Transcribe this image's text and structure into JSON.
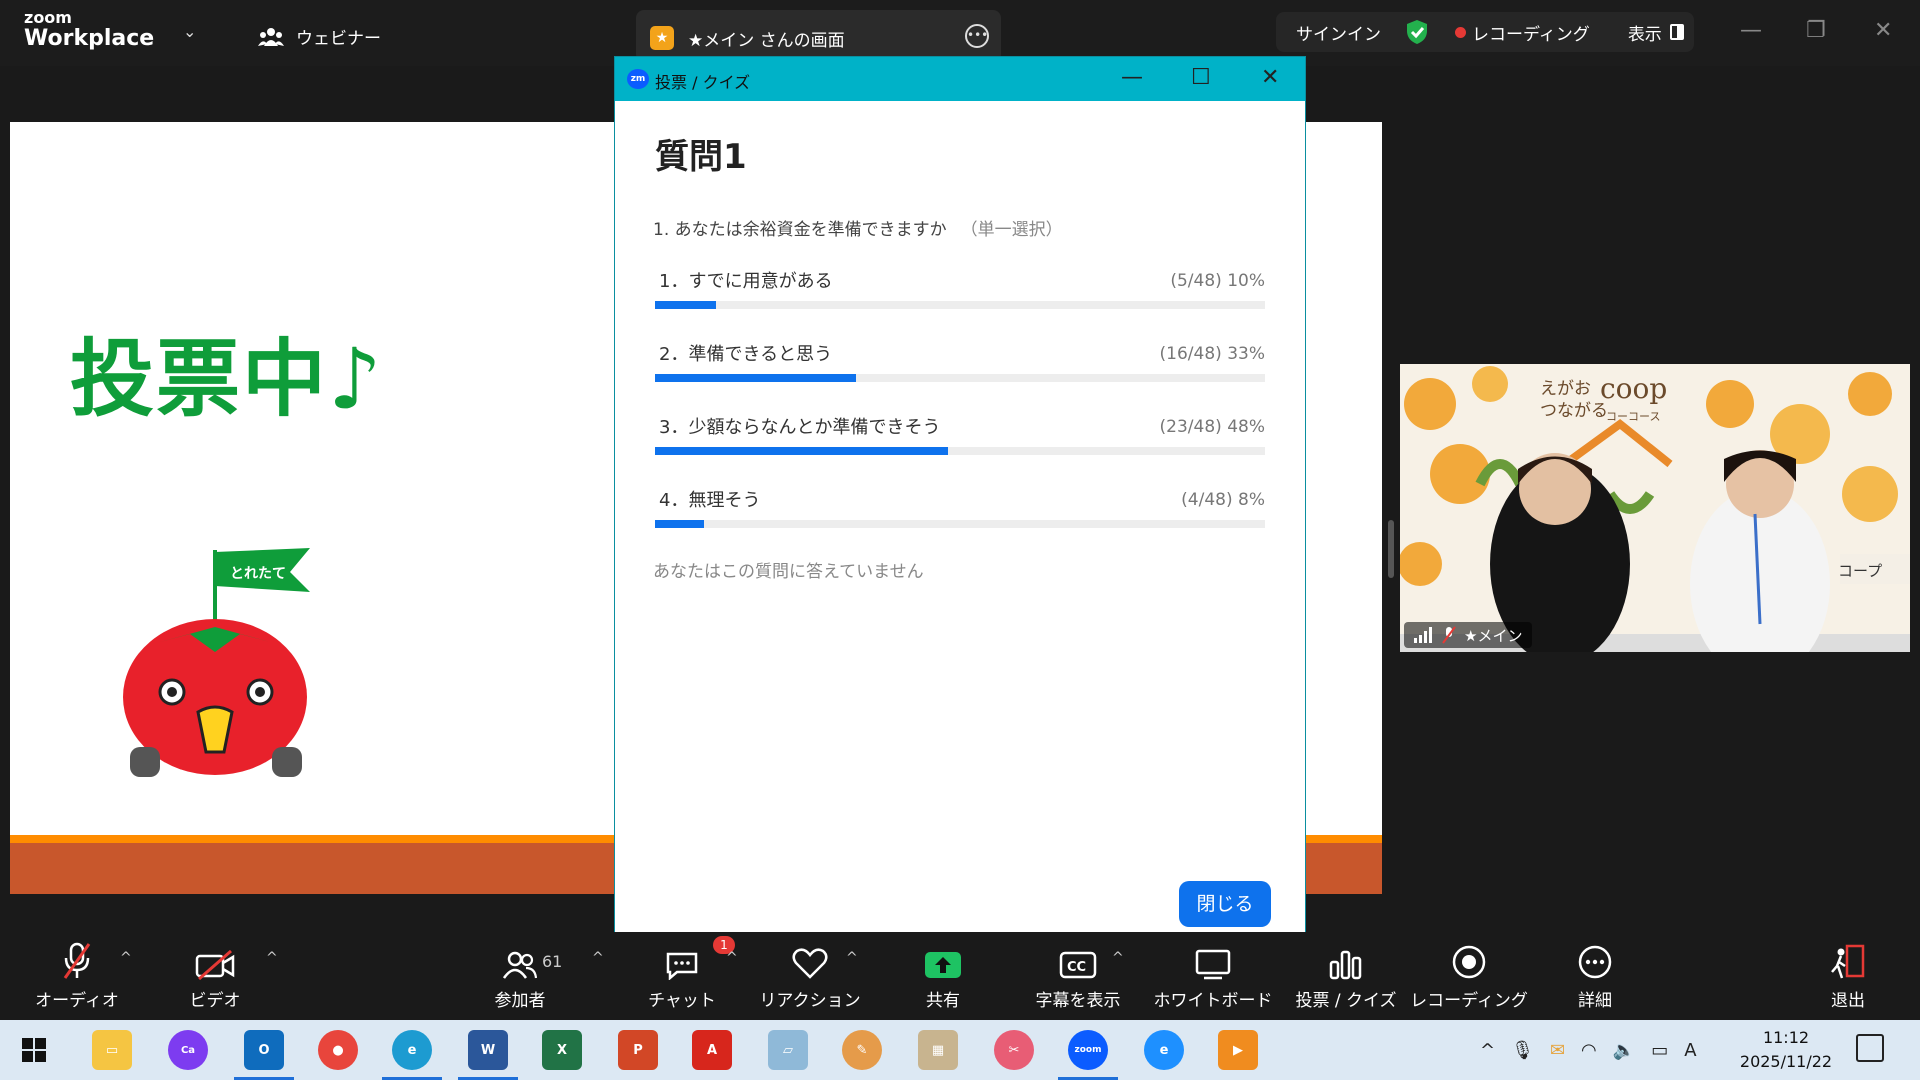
{
  "app": {
    "brand_top": "zoom",
    "brand_bottom": "Workplace",
    "webinar_label": "ウェビナー",
    "share_label": "★メイン さんの画面",
    "signin": "サインイン",
    "recording": "レコーディング",
    "view": "表示"
  },
  "slide": {
    "title": "投票中♪",
    "flag_text": "とれたて"
  },
  "video": {
    "participant_name": "★メイン",
    "brand_text_1": "えがお",
    "brand_text_2": "つながる",
    "logo": "coop",
    "logo_sub": "コーコース",
    "sign_text": "コープ"
  },
  "poll": {
    "window_title": "投票 / クイズ",
    "heading": "質問1",
    "question": "1. あなたは余裕資金を準備できますか",
    "question_type": "（単一選択）",
    "options": [
      {
        "label": "1．すでに用意がある",
        "stat": "(5/48) 10%",
        "percent": 10
      },
      {
        "label": "2．準備できると思う",
        "stat": "(16/48) 33%",
        "percent": 33
      },
      {
        "label": "3．少額ならなんとか準備できそう",
        "stat": "(23/48) 48%",
        "percent": 48
      },
      {
        "label": "4．無理そう",
        "stat": "(4/48) 8%",
        "percent": 8
      }
    ],
    "note": "あなたはこの質問に答えていません",
    "close_button": "閉じる"
  },
  "toolbar": {
    "audio": "オーディオ",
    "video": "ビデオ",
    "participants": "参加者",
    "participants_count": "61",
    "chat": "チャット",
    "chat_badge": "1",
    "reaction": "リアクション",
    "share": "共有",
    "captions": "字幕を表示",
    "whiteboard": "ホワイトボード",
    "polls": "投票 / クイズ",
    "record": "レコーディング",
    "more": "詳細",
    "leave": "退出"
  },
  "taskbar": {
    "time": "11:12",
    "date": "2025/11/22",
    "ime": "A"
  }
}
